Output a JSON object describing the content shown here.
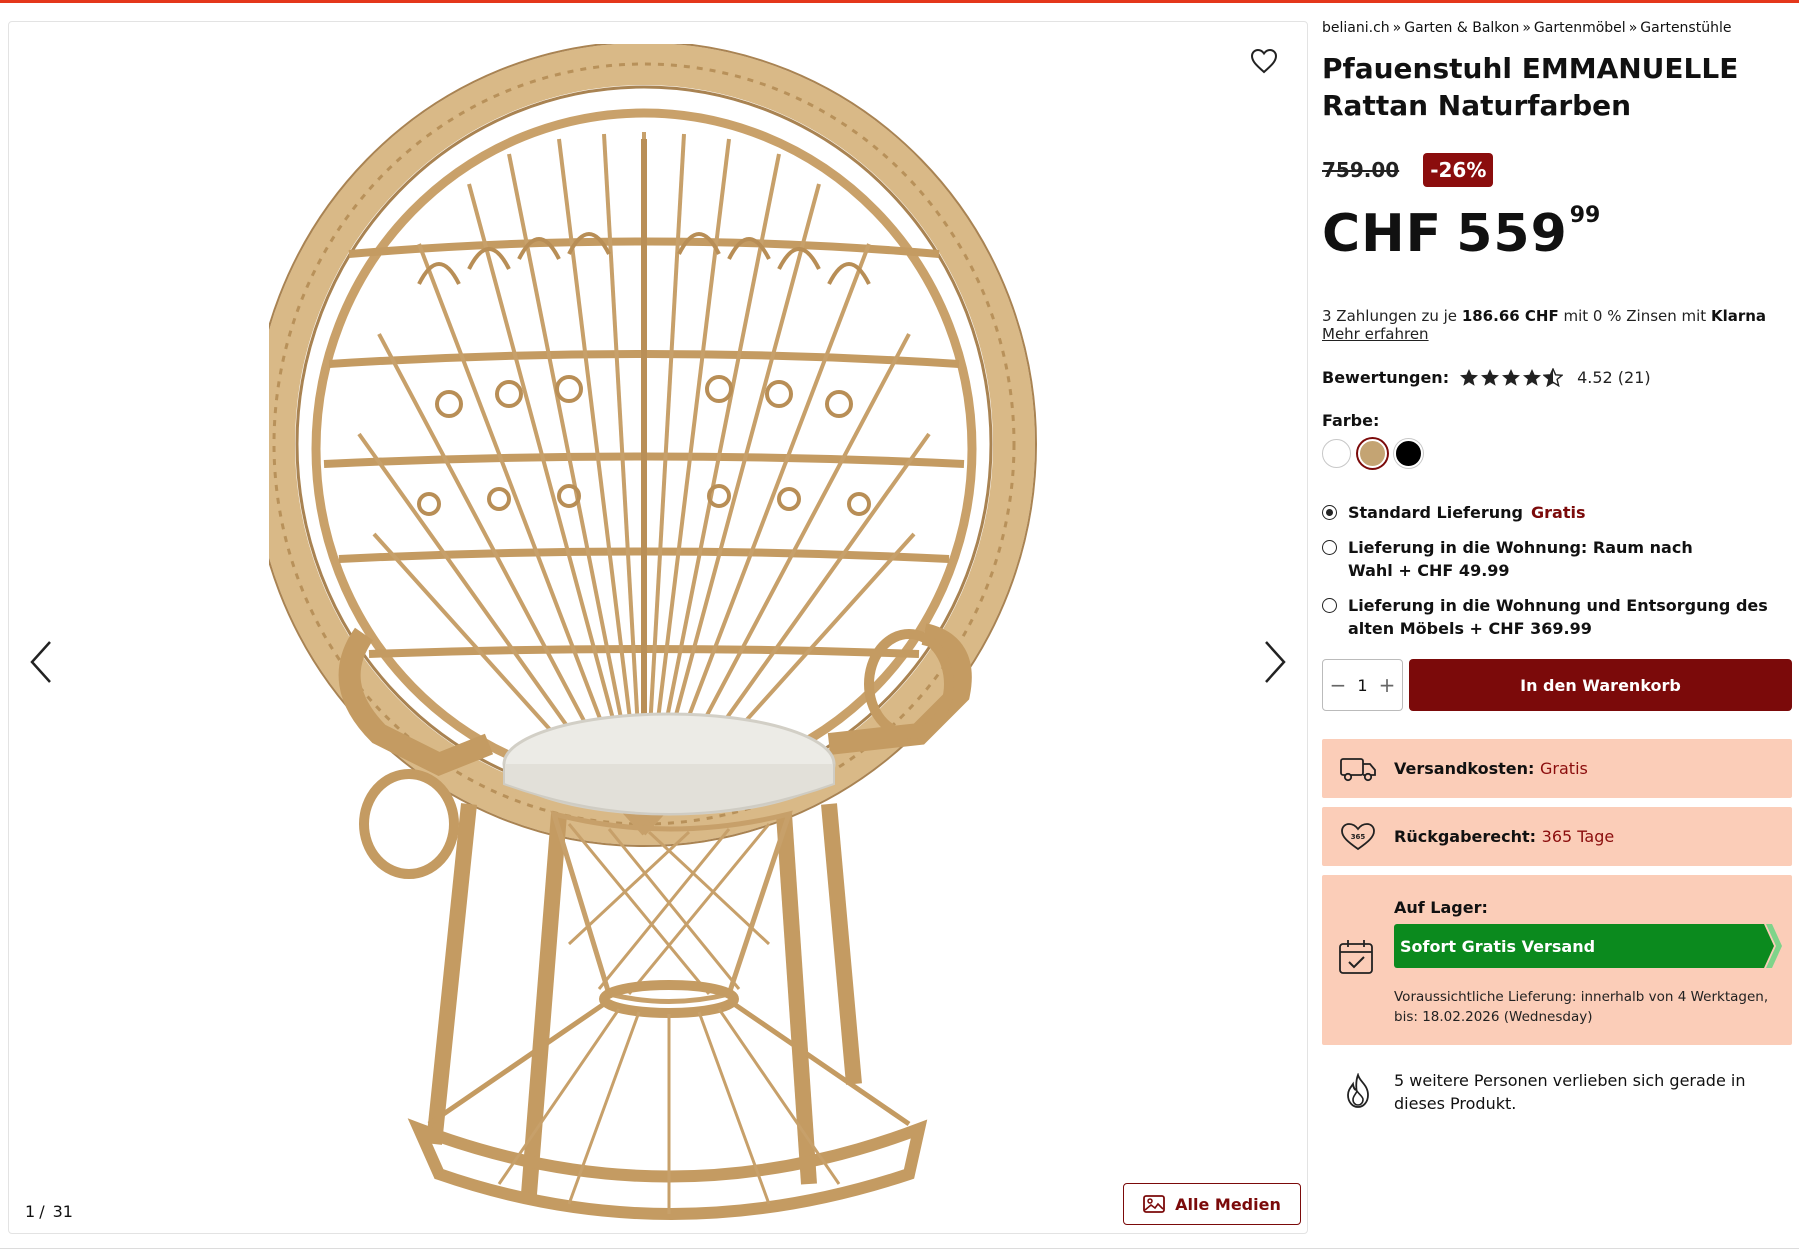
{
  "breadcrumb": [
    "beliani.ch",
    "Garten & Balkon",
    "Gartenmöbel",
    "Gartenstühle"
  ],
  "breadcrumb_separator": "»",
  "product": {
    "title": "Pfauenstuhl EMMANUELLE Rattan Naturfarben",
    "old_price": "759.00",
    "discount": "-26%",
    "currency": "CHF",
    "price_main": "559",
    "price_cents": "99"
  },
  "installments": {
    "prefix": "3 Zahlungen zu je ",
    "amount": "186.66 CHF",
    "suffix": " mit 0 % Zinsen mit ",
    "provider": "Klarna",
    "learn_more": "Mehr erfahren"
  },
  "rating": {
    "label": "Bewertungen:",
    "score": 4.52,
    "display": "4.52 (21)"
  },
  "color": {
    "label": "Farbe:",
    "options": [
      {
        "name": "white",
        "hex": "#ffffff"
      },
      {
        "name": "natural",
        "hex": "#c4a473",
        "selected": true
      },
      {
        "name": "black",
        "hex": "#000000"
      }
    ]
  },
  "delivery": {
    "options": [
      {
        "label": "Standard Lieferung",
        "extra": "Gratis",
        "selected": true
      },
      {
        "label": "Lieferung in die Wohnung: Raum nach Wahl + CHF 49.99",
        "selected": false
      },
      {
        "label": "Lieferung in die Wohnung und Entsorgung des alten Möbels + CHF 369.99",
        "selected": false
      }
    ]
  },
  "cart": {
    "quantity": "1",
    "minus": "−",
    "plus": "+",
    "button": "In den Warenkorb"
  },
  "shipping": {
    "label": "Versandkosten:",
    "value": "Gratis"
  },
  "returns": {
    "label": "Rückgaberecht:",
    "value": "365 Tage",
    "icon_text": "365"
  },
  "stock": {
    "label": "Auf Lager:",
    "badge": "Sofort Gratis Versand",
    "eta": "Voraussichtliche Lieferung: innerhalb von 4 Werktagen, bis: 18.02.2026 (Wednesday)"
  },
  "social_proof": "5 weitere Personen verlieben sich gerade in dieses Produkt.",
  "gallery": {
    "current": "1",
    "separator": "/",
    "total": "31",
    "all_media": "Alle Medien"
  },
  "colors": {
    "accent": "#7b0a0a",
    "discount_bg": "#8b0d0d",
    "info_box_bg": "#fbcdb8",
    "stock_green": "#0b8a1e",
    "top_line": "#e4371b"
  }
}
